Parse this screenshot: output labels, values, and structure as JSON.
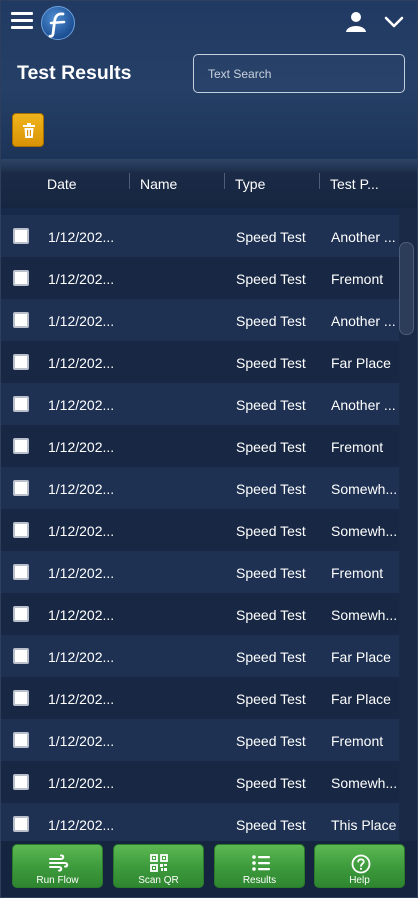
{
  "header": {
    "title": "Test Results",
    "search_placeholder": "Text Search",
    "icons": [
      "menu-icon",
      "app-logo",
      "user-icon",
      "chevron-down-icon",
      "trash-icon"
    ]
  },
  "table": {
    "columns": [
      "Date",
      "Name",
      "Type",
      "Test P..."
    ],
    "rows": [
      {
        "date": "1/12/202...",
        "name": "",
        "type": "Speed Test",
        "place": "Another ..."
      },
      {
        "date": "1/12/202...",
        "name": "",
        "type": "Speed Test",
        "place": "Fremont"
      },
      {
        "date": "1/12/202...",
        "name": "",
        "type": "Speed Test",
        "place": "Another ..."
      },
      {
        "date": "1/12/202...",
        "name": "",
        "type": "Speed Test",
        "place": "Far Place"
      },
      {
        "date": "1/12/202...",
        "name": "",
        "type": "Speed Test",
        "place": "Another ..."
      },
      {
        "date": "1/12/202...",
        "name": "",
        "type": "Speed Test",
        "place": "Fremont"
      },
      {
        "date": "1/12/202...",
        "name": "",
        "type": "Speed Test",
        "place": "Somewh..."
      },
      {
        "date": "1/12/202...",
        "name": "",
        "type": "Speed Test",
        "place": "Somewh..."
      },
      {
        "date": "1/12/202...",
        "name": "",
        "type": "Speed Test",
        "place": "Fremont"
      },
      {
        "date": "1/12/202...",
        "name": "",
        "type": "Speed Test",
        "place": "Somewh..."
      },
      {
        "date": "1/12/202...",
        "name": "",
        "type": "Speed Test",
        "place": "Far Place"
      },
      {
        "date": "1/12/202...",
        "name": "",
        "type": "Speed Test",
        "place": "Far Place"
      },
      {
        "date": "1/12/202...",
        "name": "",
        "type": "Speed Test",
        "place": "Fremont"
      },
      {
        "date": "1/12/202...",
        "name": "",
        "type": "Speed Test",
        "place": "Somewh..."
      },
      {
        "date": "1/12/202...",
        "name": "",
        "type": "Speed Test",
        "place": "This Place"
      }
    ]
  },
  "bottom_nav": [
    {
      "label": "Run Flow",
      "icon": "wind-flow-icon"
    },
    {
      "label": "Scan QR",
      "icon": "qr-code-icon"
    },
    {
      "label": "Results",
      "icon": "list-icon"
    },
    {
      "label": "Help",
      "icon": "help-circle-icon"
    }
  ],
  "colors": {
    "header_bg": "#253f66",
    "row_even": "#1e3152",
    "row_odd": "#182844",
    "delete_button": "#e5a30f",
    "nav_button": "#47a544"
  }
}
